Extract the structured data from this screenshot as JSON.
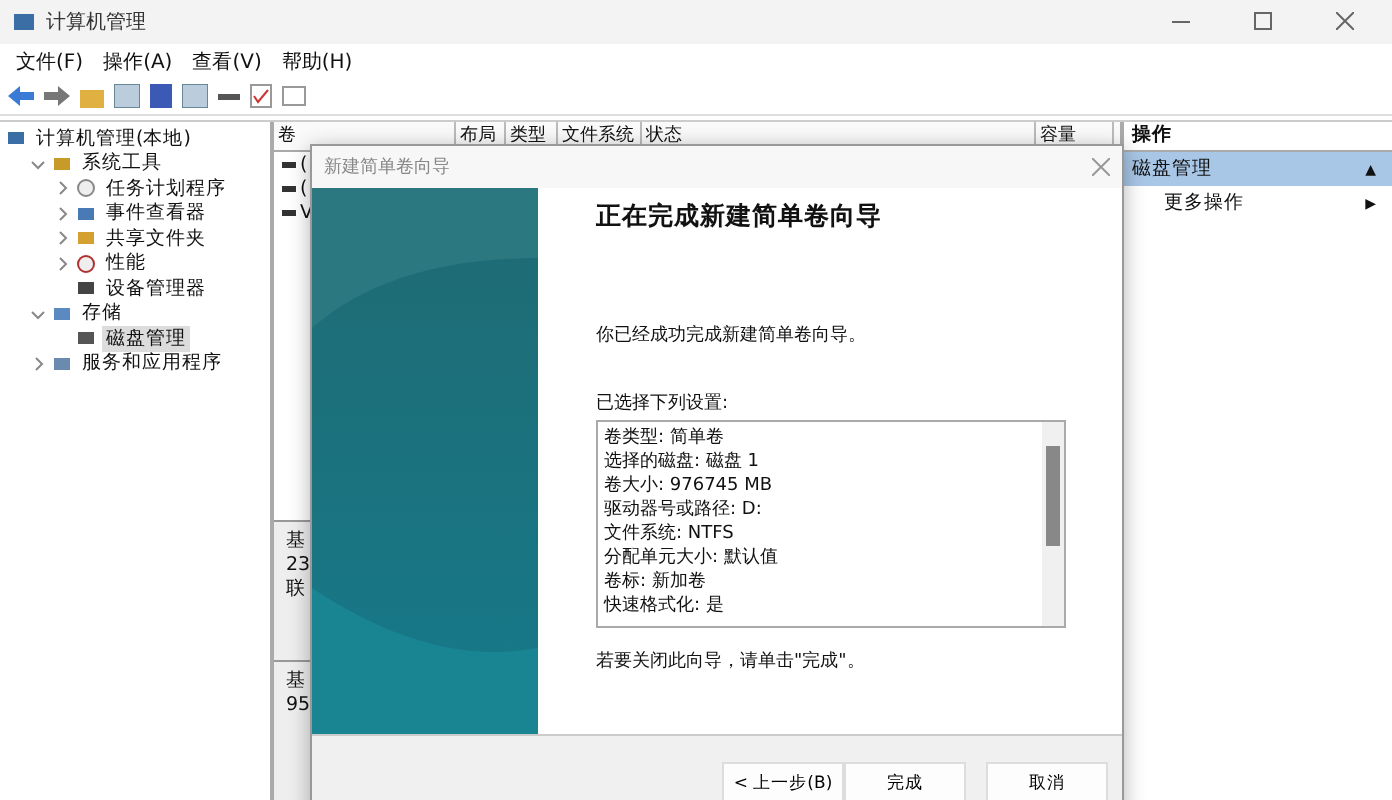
{
  "window": {
    "title": "计算机管理"
  },
  "menu": [
    "文件(F)",
    "操作(A)",
    "查看(V)",
    "帮助(H)"
  ],
  "tree": [
    {
      "label": "计算机管理(本地)",
      "selected": false,
      "children": [
        {
          "label": "系统工具",
          "selected": false,
          "expanded": true,
          "children": [
            {
              "label": "任务计划程序",
              "selected": false,
              "expanded": false
            },
            {
              "label": "事件查看器",
              "selected": false,
              "expanded": false
            },
            {
              "label": "共享文件夹",
              "selected": false,
              "expanded": false
            },
            {
              "label": "性能",
              "selected": false,
              "expanded": false
            },
            {
              "label": "设备管理器",
              "selected": false
            }
          ]
        },
        {
          "label": "存储",
          "selected": false,
          "expanded": true,
          "children": [
            {
              "label": "磁盘管理",
              "selected": true
            }
          ]
        },
        {
          "label": "服务和应用程序",
          "selected": false,
          "expanded": false
        }
      ]
    }
  ],
  "columns": [
    "卷",
    "布局",
    "类型",
    "文件系统",
    "状态",
    "容量"
  ],
  "volume_rows": [
    "(",
    "(",
    "V"
  ],
  "disk_rows": [
    [
      "基",
      "23",
      "联"
    ],
    [
      "基",
      "95"
    ]
  ],
  "actions": {
    "header": "操作",
    "items": [
      {
        "label": "磁盘管理",
        "selected": true,
        "arrow": "▲"
      },
      {
        "label": "更多操作",
        "selected": false,
        "arrow": "▶"
      }
    ]
  },
  "dialog": {
    "title": "新建简单卷向导",
    "heading": "正在完成新建简单卷向导",
    "intro": "你已经成功完成新建简单卷向导。",
    "settings_label": "已选择下列设置:",
    "settings": [
      "卷类型: 简单卷",
      "选择的磁盘: 磁盘 1",
      "卷大小: 976745 MB",
      "驱动器号或路径: D:",
      "文件系统: NTFS",
      "分配单元大小: 默认值",
      "卷标: 新加卷",
      "快速格式化: 是"
    ],
    "outro": "若要关闭此向导，请单击\"完成\"。",
    "buttons": [
      {
        "label": "< 上一步(B)"
      },
      {
        "label": "完成"
      },
      {
        "label": "取消"
      }
    ]
  }
}
